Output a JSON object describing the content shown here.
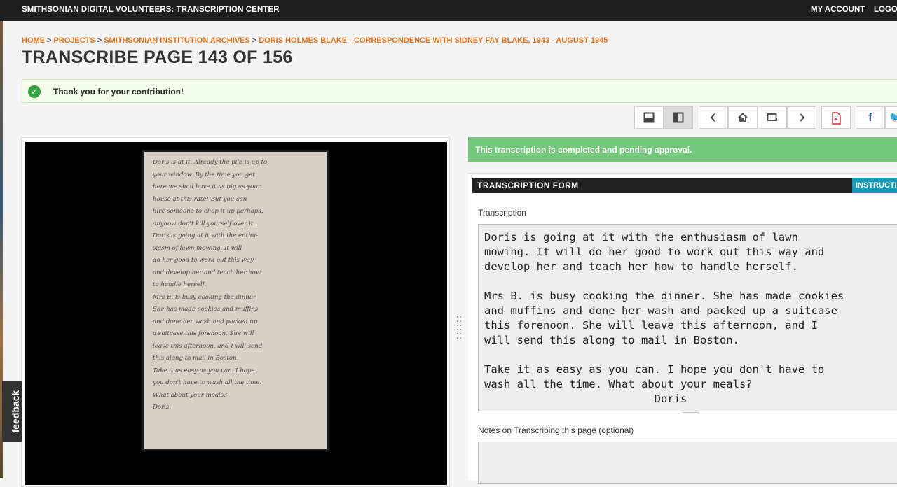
{
  "topbar": {
    "brand": "SMITHSONIAN DIGITAL VOLUNTEERS: TRANSCRIPTION CENTER",
    "my_account": "MY ACCOUNT",
    "logout": "LOGOUT"
  },
  "breadcrumb": {
    "items": [
      "HOME",
      "PROJECTS",
      "SMITHSONIAN INSTITUTION ARCHIVES",
      "DORIS HOLMES BLAKE - CORRESPONDENCE WITH SIDNEY FAY BLAKE, 1943 - AUGUST 1945"
    ],
    "separator": ">"
  },
  "page_title": "TRANSCRIBE PAGE 143 OF 156",
  "alert": {
    "message": "Thank you for your contribution!"
  },
  "toolbar": {
    "icons": [
      "layout-horizontal-icon",
      "layout-vertical-icon",
      "prev-icon",
      "home-icon",
      "slideshow-icon",
      "next-icon",
      "pdf-icon",
      "facebook-icon",
      "twitter-icon"
    ]
  },
  "document": {
    "handwriting": [
      "Doris is at it. Already the pile is up to",
      "your window. By the time you get",
      "here we shall have it as big as your",
      "house at this rate! But you can",
      "hire someone to chop it up perhaps,",
      "anyhow don't kill yourself over it.",
      "Doris is going at it with the enthu-",
      "siasm of lawn mowing. It will",
      "do her good to work out this way",
      "and develop her and teach her how",
      "to handle herself.",
      "    Mrs B. is busy cooking the dinner",
      "She has made cookies and muffins",
      "and done her wash and packed up",
      "a suitcase this forenoon. She will",
      "leave this afternoon, and I will send",
      "this along to mail in Boston.",
      "    Take it as easy as you can. I hope",
      "you don't have to wash all the time.",
      "What about your meals?",
      "                        Doris."
    ]
  },
  "status": {
    "text": "This transcription is completed and pending approval."
  },
  "form": {
    "header": "TRANSCRIPTION FORM",
    "instructions": "INSTRUCTIONS",
    "transcription_label": "Transcription",
    "transcription_value": "Doris is going at it with the enthusiasm of lawn\nmowing. It will do her good to work out this way and\ndevelop her and teach her how to handle herself.\n\nMrs B. is busy cooking the dinner. She has made cookies\nand muffins and done her wash and packed up a suitcase\nthis forenoon. She will leave this afternoon, and I\nwill send this along to mail in Boston.\n\nTake it as easy as you can. I hope you don't have to\nwash all the time. What about your meals?\n                          Doris",
    "notes_label": "Notes on Transcribing this page (optional)",
    "notes_value": ""
  },
  "feedback": {
    "label": "feedback"
  },
  "colors": {
    "accent_orange": "#e8731a",
    "success_green": "#73c67a",
    "instructions_blue": "#1698b6",
    "topbar": "#1e1e1e"
  }
}
